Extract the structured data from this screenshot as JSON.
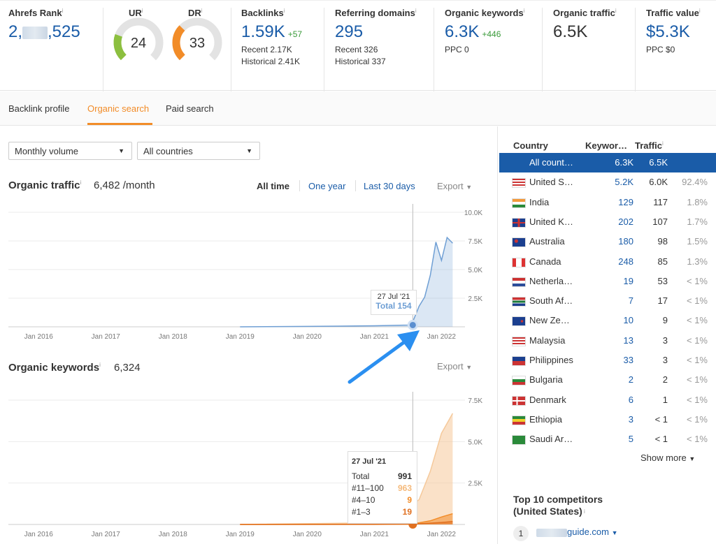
{
  "metrics": {
    "ahrefs_rank": {
      "label": "Ahrefs Rank",
      "value_start": "2,",
      "value_end": ",525"
    },
    "ur": {
      "label": "UR",
      "value": "24",
      "score": 24,
      "color": "#8cbf3f"
    },
    "dr": {
      "label": "DR",
      "value": "33",
      "score": 33,
      "color": "#f28c28"
    },
    "backlinks": {
      "label": "Backlinks",
      "value": "1.59K",
      "delta": "+57",
      "recent": "Recent 2.17K",
      "historical": "Historical 2.41K"
    },
    "referring_domains": {
      "label": "Referring domains",
      "value": "295",
      "recent": "Recent 326",
      "historical": "Historical 337"
    },
    "organic_keywords": {
      "label": "Organic keywords",
      "value": "6.3K",
      "delta": "+446",
      "sub": "PPC 0"
    },
    "organic_traffic": {
      "label": "Organic traffic",
      "value": "6.5K"
    },
    "traffic_value": {
      "label": "Traffic value",
      "value": "$5.3K",
      "sub": "PPC $0"
    }
  },
  "tabs": [
    "Backlink profile",
    "Organic search",
    "Paid search"
  ],
  "filters": {
    "volume": "Monthly volume",
    "countries": "All countries"
  },
  "traffic_section": {
    "title": "Organic traffic",
    "value": "6,482 /month",
    "time_ranges": [
      "All time",
      "One year",
      "Last 30 days"
    ],
    "export": "Export",
    "tooltip": {
      "date": "27 Jul '21",
      "total": "Total 154"
    }
  },
  "keywords_section": {
    "title": "Organic keywords",
    "value": "6,324",
    "export": "Export",
    "tooltip": {
      "date": "27 Jul '21",
      "rows": [
        {
          "label": "Total",
          "value": "991",
          "color": "#333"
        },
        {
          "label": "#11–100",
          "value": "963",
          "color": "#f5b97a"
        },
        {
          "label": "#4–10",
          "value": "9",
          "color": "#f28c28"
        },
        {
          "label": "#1–3",
          "value": "19",
          "color": "#e07020"
        }
      ]
    }
  },
  "chart_data": [
    {
      "type": "area",
      "title": "Organic traffic",
      "x_ticks": [
        "Jan 2016",
        "Jan 2017",
        "Jan 2018",
        "Jan 2019",
        "Jan 2020",
        "Jan 2021",
        "Jan 2022"
      ],
      "y_ticks": [
        "2.5K",
        "5.0K",
        "7.5K",
        "10.0K"
      ],
      "ylim": [
        0,
        10000
      ],
      "series": [
        {
          "color": "#6f9fd4",
          "x": [
            "Jan 2019",
            "Jan 2020",
            "Jul 2020",
            "Jan 2021",
            "Jul 2021",
            "Aug 2021",
            "Sep 2021",
            "Oct 2021",
            "Nov 2021",
            "Dec 2021",
            "Jan 2022",
            "Feb 2022",
            "Mar 2022"
          ],
          "values": [
            0,
            40,
            60,
            90,
            154,
            600,
            1800,
            2600,
            4500,
            7400,
            5800,
            7800,
            7300
          ]
        }
      ],
      "annotation": {
        "x": "27 Jul '21",
        "value": 154
      }
    },
    {
      "type": "area",
      "title": "Organic keywords",
      "x_ticks": [
        "Jan 2016",
        "Jan 2017",
        "Jan 2018",
        "Jan 2019",
        "Jan 2020",
        "Jan 2021",
        "Jan 2022"
      ],
      "y_ticks": [
        "2.5K",
        "5.0K",
        "7.5K"
      ],
      "ylim": [
        0,
        7500
      ],
      "series": [
        {
          "name": "#11–100",
          "color": "#f5c99b",
          "x": [
            "Jan 2019",
            "Jan 2021",
            "Jul 2021",
            "Sep 2021",
            "Nov 2021",
            "Jan 2022",
            "Mar 2022"
          ],
          "values": [
            0,
            100,
            963,
            1500,
            3200,
            5500,
            6700
          ]
        },
        {
          "name": "#4–10",
          "color": "#f28c28",
          "x": [
            "Jan 2019",
            "Jan 2021",
            "Jul 2021",
            "Sep 2021",
            "Nov 2021",
            "Jan 2022",
            "Mar 2022"
          ],
          "values": [
            0,
            5,
            9,
            100,
            220,
            450,
            650
          ]
        },
        {
          "name": "#1–3",
          "color": "#e07020",
          "x": [
            "Jan 2019",
            "Jan 2021",
            "Jul 2021",
            "Sep 2021",
            "Nov 2021",
            "Jan 2022",
            "Mar 2022"
          ],
          "values": [
            0,
            5,
            19,
            40,
            80,
            120,
            180
          ]
        }
      ],
      "annotation": {
        "x": "27 Jul '21",
        "value": 991
      }
    }
  ],
  "countries": {
    "headers": {
      "country": "Country",
      "keywords": "Keywor…",
      "traffic": "Traffic"
    },
    "rows": [
      {
        "name": "All count…",
        "keywords": "6.3K",
        "traffic": "6.5K",
        "pct": "",
        "flag": "none"
      },
      {
        "name": "United S…",
        "keywords": "5.2K",
        "traffic": "6.0K",
        "pct": "92.4%",
        "flag": "us"
      },
      {
        "name": "India",
        "keywords": "129",
        "traffic": "117",
        "pct": "1.8%",
        "flag": "in"
      },
      {
        "name": "United K…",
        "keywords": "202",
        "traffic": "107",
        "pct": "1.7%",
        "flag": "gb"
      },
      {
        "name": "Australia",
        "keywords": "180",
        "traffic": "98",
        "pct": "1.5%",
        "flag": "au"
      },
      {
        "name": "Canada",
        "keywords": "248",
        "traffic": "85",
        "pct": "1.3%",
        "flag": "ca"
      },
      {
        "name": "Netherla…",
        "keywords": "19",
        "traffic": "53",
        "pct": "< 1%",
        "flag": "nl"
      },
      {
        "name": "South Af…",
        "keywords": "7",
        "traffic": "17",
        "pct": "< 1%",
        "flag": "za"
      },
      {
        "name": "New Ze…",
        "keywords": "10",
        "traffic": "9",
        "pct": "< 1%",
        "flag": "nz"
      },
      {
        "name": "Malaysia",
        "keywords": "13",
        "traffic": "3",
        "pct": "< 1%",
        "flag": "my"
      },
      {
        "name": "Philippines",
        "keywords": "33",
        "traffic": "3",
        "pct": "< 1%",
        "flag": "ph"
      },
      {
        "name": "Bulgaria",
        "keywords": "2",
        "traffic": "2",
        "pct": "< 1%",
        "flag": "bg"
      },
      {
        "name": "Denmark",
        "keywords": "6",
        "traffic": "1",
        "pct": "< 1%",
        "flag": "dk"
      },
      {
        "name": "Ethiopia",
        "keywords": "3",
        "traffic": "< 1",
        "pct": "< 1%",
        "flag": "et"
      },
      {
        "name": "Saudi Ar…",
        "keywords": "5",
        "traffic": "< 1",
        "pct": "< 1%",
        "flag": "sa"
      }
    ],
    "show_more": "Show more"
  },
  "competitors": {
    "title_line1": "Top 10 competitors",
    "title_line2": "(United States)",
    "first": {
      "rank": "1",
      "domain": "guide.com"
    }
  }
}
